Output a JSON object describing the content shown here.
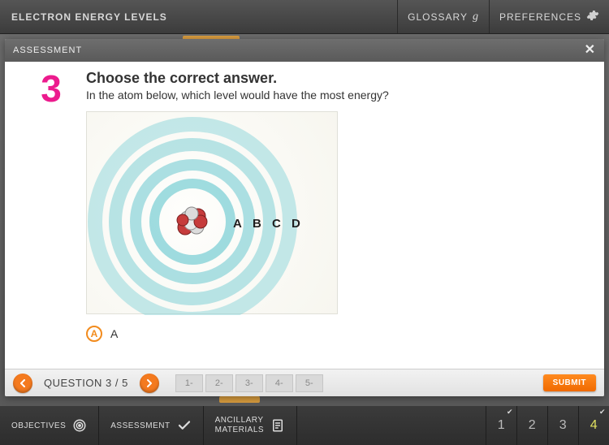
{
  "header": {
    "title": "ELECTRON ENERGY LEVELS",
    "glossary": "GLOSSARY",
    "preferences": "PREFERENCES"
  },
  "modal": {
    "title": "ASSESSMENT",
    "question_number": "3",
    "question_title": "Choose the correct answer.",
    "question_prompt": "In the atom below, which level would have the most energy?",
    "diagram_labels": [
      "A",
      "B",
      "C",
      "D"
    ],
    "answers": [
      {
        "letter": "A",
        "text": "A"
      }
    ]
  },
  "footer": {
    "counter": "QUESTION 3 / 5",
    "boxes": [
      "1-",
      "2-",
      "3-",
      "4-",
      "5-"
    ],
    "submit": "SUBMIT"
  },
  "bottom": {
    "objectives": "OBJECTIVES",
    "assessment": "ASSESSMENT",
    "ancillary1": "ANCILLARY",
    "ancillary2": "MATERIALS",
    "nums": [
      "1",
      "2",
      "3",
      "4"
    ]
  }
}
